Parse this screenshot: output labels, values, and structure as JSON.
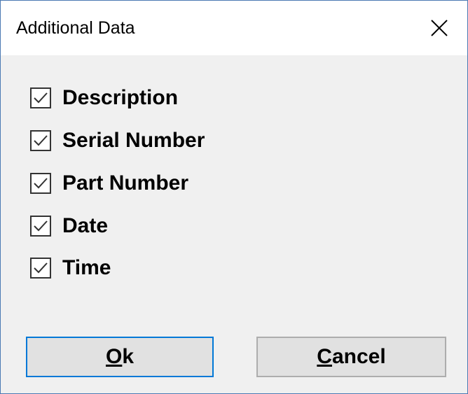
{
  "window": {
    "title": "Additional Data"
  },
  "checklist": {
    "items": [
      {
        "label": "Description",
        "checked": true
      },
      {
        "label": "Serial Number",
        "checked": true
      },
      {
        "label": "Part Number",
        "checked": true
      },
      {
        "label": "Date",
        "checked": true
      },
      {
        "label": "Time",
        "checked": true
      }
    ]
  },
  "buttons": {
    "ok": {
      "mnemonic": "O",
      "rest": "k"
    },
    "cancel": {
      "mnemonic": "C",
      "rest": "ancel"
    }
  },
  "icons": {
    "close": "close-icon",
    "check": "check-icon"
  },
  "colors": {
    "accent": "#0078d7",
    "window_border": "#4a79b3",
    "dialog_background": "#f0f0f0",
    "button_background": "#e1e1e1"
  }
}
